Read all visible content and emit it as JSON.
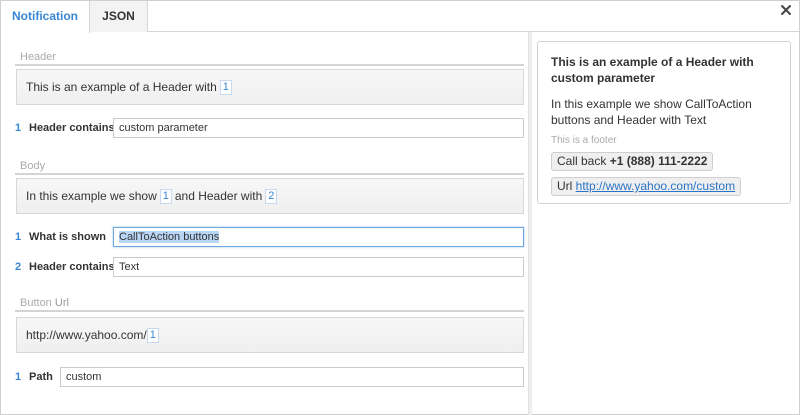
{
  "tabs": [
    {
      "label": "Notification",
      "active": true
    },
    {
      "label": "JSON",
      "active": false
    }
  ],
  "header": {
    "section_title": "Header",
    "template_text": "This is an example of a Header with",
    "placeholder": "1",
    "params": [
      {
        "index": "1",
        "label": "Header contains",
        "value": "custom parameter"
      }
    ]
  },
  "body": {
    "section_title": "Body",
    "template_text_1": "In this example we show",
    "placeholder_1": "1",
    "template_text_2": "and Header with",
    "placeholder_2": "2",
    "params": [
      {
        "index": "1",
        "label": "What is shown",
        "value": "CallToAction buttons"
      },
      {
        "index": "2",
        "label": "Header contains",
        "value": "Text"
      }
    ]
  },
  "button_url": {
    "section_title_prefix": "Button",
    "section_title_suffix": "Url",
    "template_text": "http://www.yahoo.com/",
    "placeholder": "1",
    "params": [
      {
        "index": "1",
        "label": "Path",
        "value": "custom"
      }
    ]
  },
  "preview": {
    "header": "This is an example of a Header with custom parameter",
    "body": "In this example we show CallToAction buttons and Header with Text",
    "footer": "This is a footer",
    "call_button_label": "Call back",
    "call_button_number": "+1 (888) 111-2222",
    "url_button_label": "Url",
    "url_button_link": "http://www.yahoo.com/custom"
  },
  "colors": {
    "accent": "#3a86d4",
    "link": "#2a73c7"
  },
  "icons": {
    "close": "close-icon"
  }
}
